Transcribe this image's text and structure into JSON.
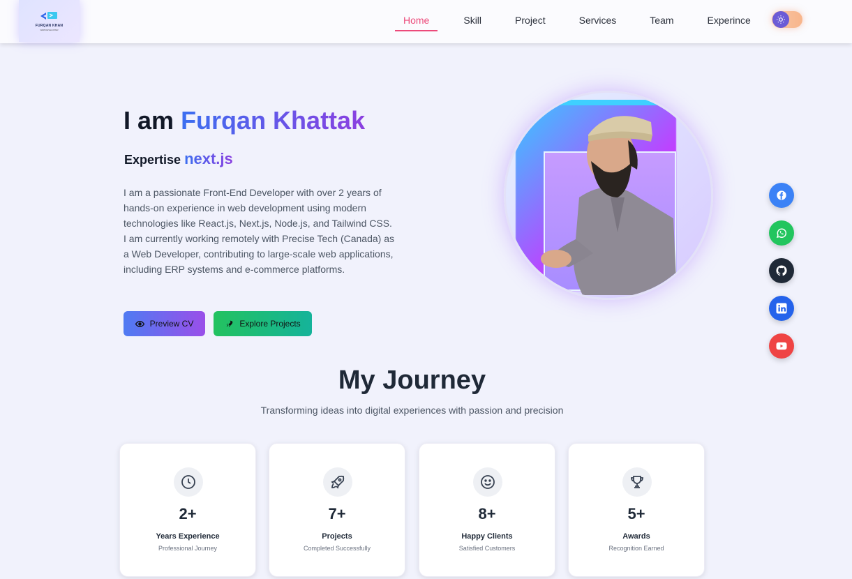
{
  "brand": {
    "name": "FURQAN KHAN",
    "tagline": "WEB DEVELOPER"
  },
  "nav": {
    "items": [
      "Home",
      "Skill",
      "Project",
      "Services",
      "Team",
      "Experince"
    ],
    "active": "Home"
  },
  "theme_toggle": {
    "icon": "sun-icon",
    "state": "light"
  },
  "hero": {
    "greeting": "I am",
    "name": "Furqan Khattak",
    "expertise_label": "Expertise",
    "expertise_value": "next.js",
    "bio": "I am a passionate Front-End Developer with over 2 years of hands-on experience in web development using modern technologies like React.js, Next.js, Node.js, and Tailwind CSS. I am currently working remotely with Precise Tech (Canada) as a Web Developer, contributing to large-scale web applications, including ERP systems and e-commerce platforms.",
    "buttons": {
      "preview_cv": "Preview CV",
      "explore_projects": "Explore Projects"
    }
  },
  "social": [
    {
      "name": "facebook-icon",
      "color": "#3b82f6"
    },
    {
      "name": "whatsapp-icon",
      "color": "#22c55e"
    },
    {
      "name": "github-icon",
      "color": "#1f2937"
    },
    {
      "name": "linkedin-icon",
      "color": "#2563eb"
    },
    {
      "name": "youtube-icon",
      "color": "#ef4444"
    }
  ],
  "journey": {
    "title": "My Journey",
    "subtitle": "Transforming ideas into digital experiences with passion and precision",
    "stats": [
      {
        "icon": "clock-icon",
        "value": "2+",
        "label": "Years Experience",
        "sub": "Professional Journey"
      },
      {
        "icon": "rocket-icon",
        "value": "7+",
        "label": "Projects",
        "sub": "Completed Successfully"
      },
      {
        "icon": "smile-icon",
        "value": "8+",
        "label": "Happy Clients",
        "sub": "Satisfied Customers"
      },
      {
        "icon": "trophy-icon",
        "value": "5+",
        "label": "Awards",
        "sub": "Recognition Earned"
      }
    ]
  },
  "colors": {
    "accent_active": "#ec4a7a",
    "gradient_start": "#3b6ff0",
    "gradient_end": "#8b3fe0",
    "background": "#f1f2fc"
  }
}
